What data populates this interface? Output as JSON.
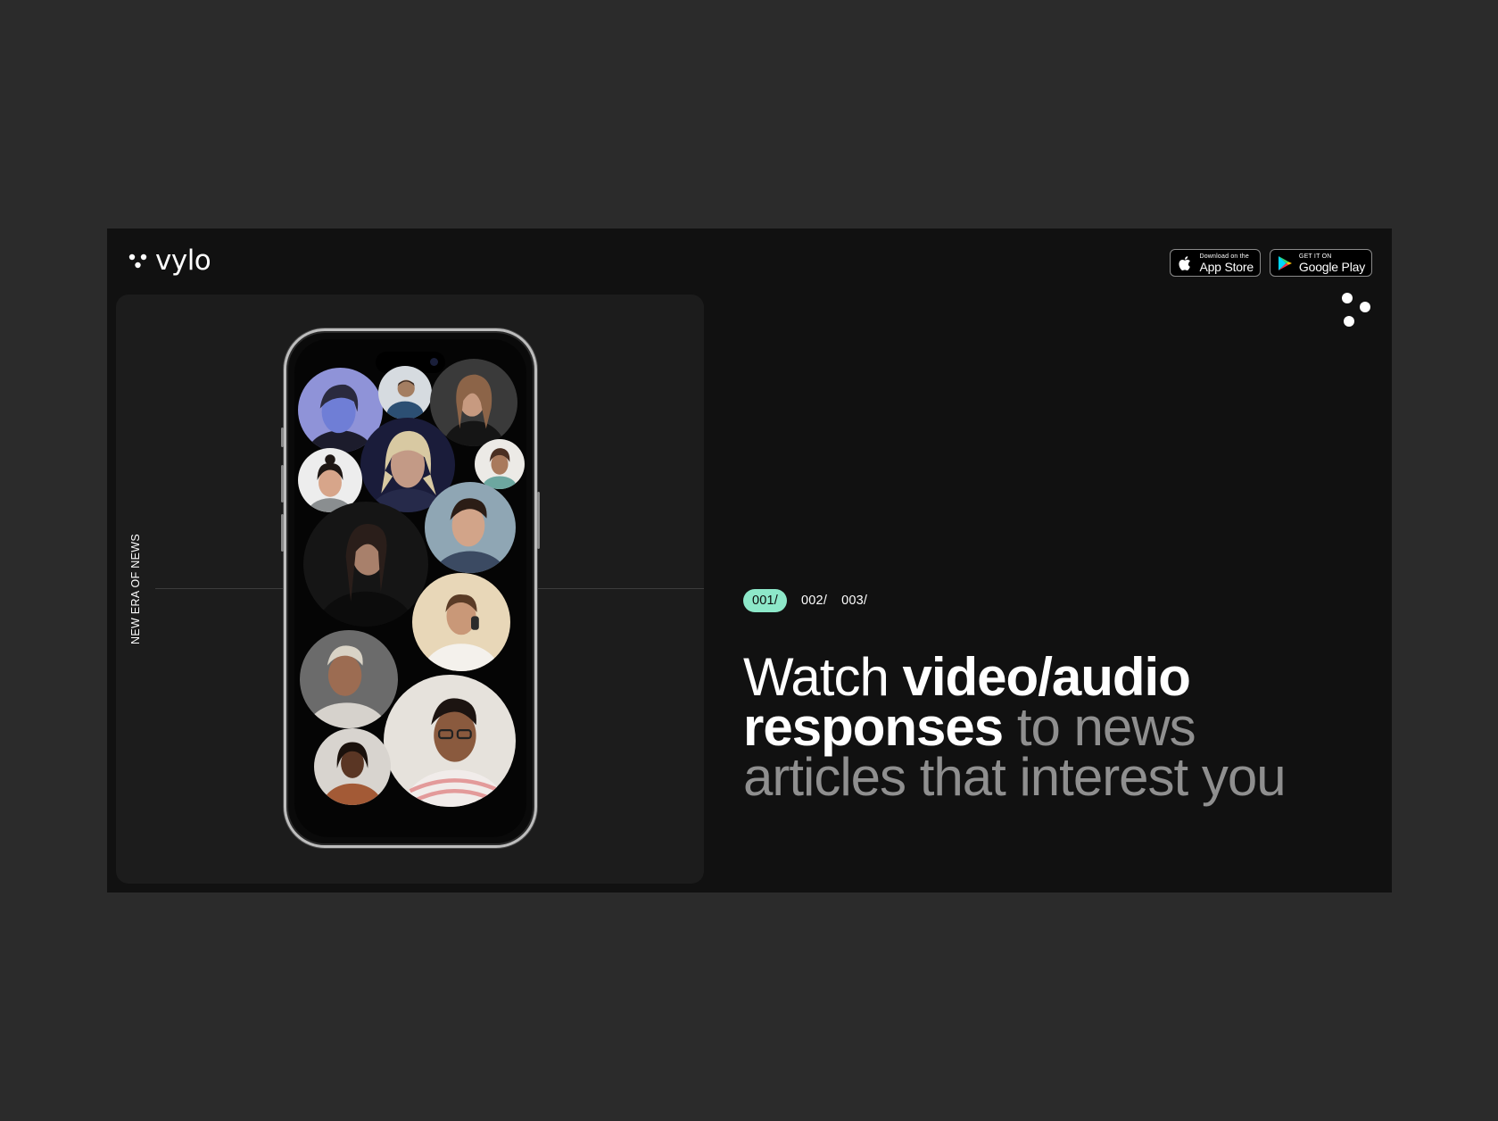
{
  "brand": {
    "name": "vylo",
    "logo_icon": "three-dots-logo-icon"
  },
  "stores": {
    "app_store": {
      "small": "Download on the",
      "big": "App Store",
      "icon": "apple-icon"
    },
    "google_play": {
      "small": "GET IT ON",
      "big": "Google Play",
      "icon": "google-play-icon"
    }
  },
  "menu_icon": "dots-menu-icon",
  "left_panel": {
    "vertical_label": "NEW ERA OF NEWS"
  },
  "steps": [
    "001/",
    "002/",
    "003/"
  ],
  "active_step": 0,
  "headline": {
    "part1": "Watch ",
    "part2": "video/audio responses",
    "part3": " to news articles that interest you"
  },
  "colors": {
    "background": "#2b2b2b",
    "frame": "#111111",
    "card": "#1c1c1c",
    "accent": "#8de8c9",
    "muted_text": "#8f8f8f"
  }
}
